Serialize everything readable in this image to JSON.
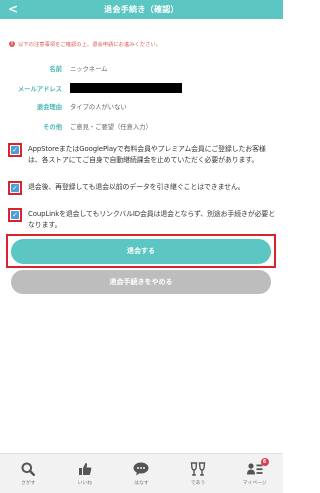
{
  "header": {
    "back_icon": "chevron-left-icon",
    "back_glyph": "<",
    "title": "退会手続き（確認）"
  },
  "notice": {
    "icon_glyph": "!",
    "text": "以下の注意事項をご確認の上、退会申請にお進みください。"
  },
  "info": [
    {
      "label": "名前",
      "value": "ニックネーム"
    },
    {
      "label": "メールアドレス",
      "value": ""
    },
    {
      "label": "退会理由",
      "value": "タイプの人がいない"
    },
    {
      "label": "その他",
      "value": "ご意見・ご要望（任意入力）"
    }
  ],
  "checks": [
    {
      "checked": true,
      "mark": "✓",
      "text": "AppStoreまたはGooglePlayで有料会員やプレミアム会員にご登録したお客様は、各ストアにてご自身で自動継続課金を止めていただく必要があります。"
    },
    {
      "checked": true,
      "mark": "✓",
      "text": "退会後、再登録しても退会以前のデータを引き継ぐことはできません。"
    },
    {
      "checked": true,
      "mark": "✓",
      "text": "CoupLinkを退会してもリンクバルID会員は退会とならず、別途お手続きが必要となります。"
    }
  ],
  "buttons": {
    "confirm_label": "退会する",
    "cancel_label": "退会手続きをやめる"
  },
  "nav": [
    {
      "icon": "search-icon",
      "label": "さがす"
    },
    {
      "icon": "thumbs-up-icon",
      "label": "いいね"
    },
    {
      "icon": "chat-bubble-icon",
      "label": "はなす"
    },
    {
      "icon": "glasses-cheers-icon",
      "label": "であう"
    },
    {
      "icon": "user-menu-icon",
      "label": "マイページ",
      "badge": "6"
    }
  ],
  "colors": {
    "accent": "#5cc6c2",
    "warning": "#e05a5a",
    "highlight_frame": "#d9232e",
    "checkbox": "#4a9ed4",
    "disabled_button": "#bdbdbd",
    "badge": "#e03b54"
  }
}
